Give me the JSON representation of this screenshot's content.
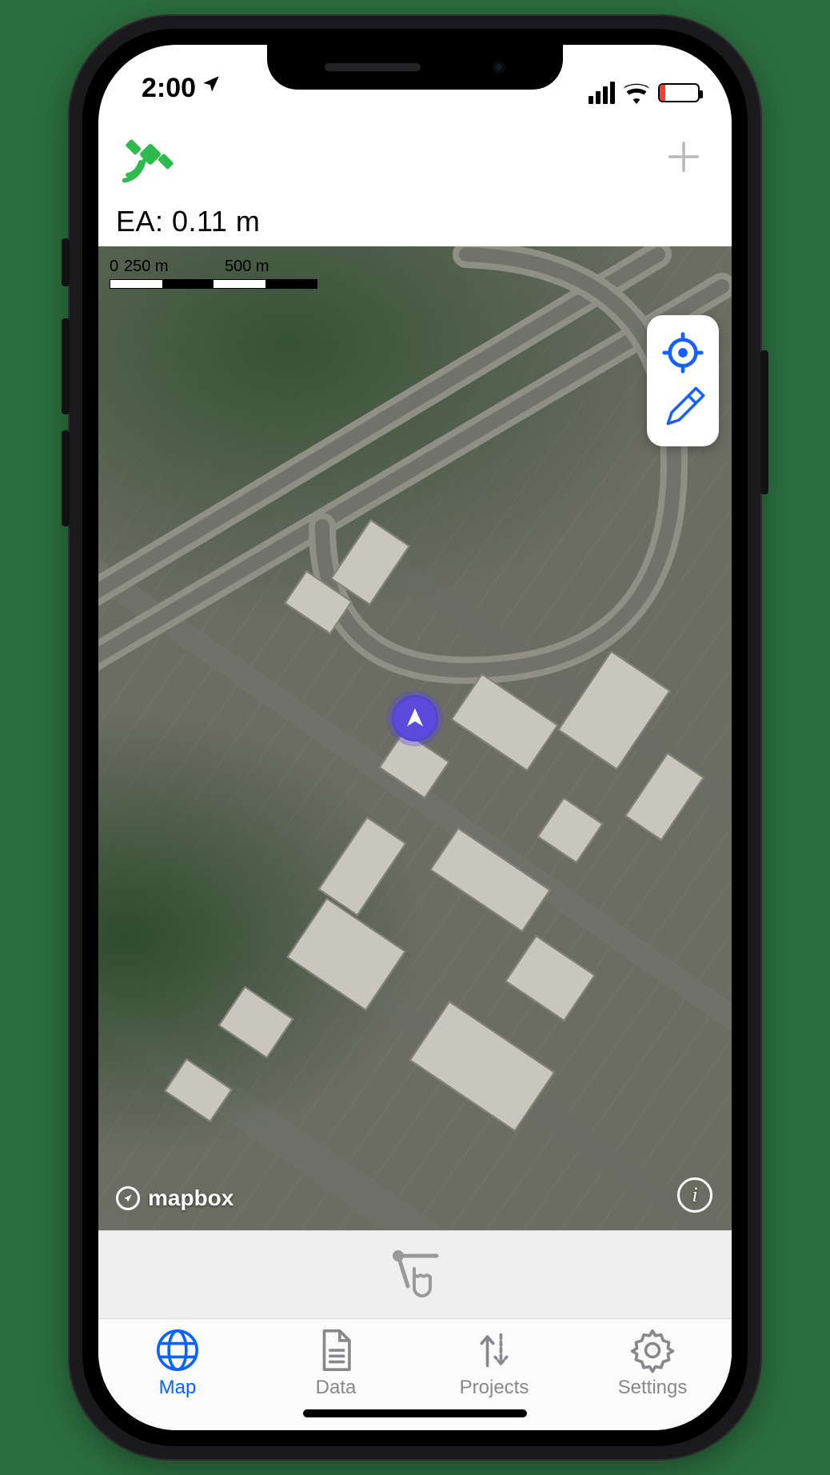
{
  "statusbar": {
    "time": "2:00",
    "location_services_on": true,
    "battery_low": true
  },
  "appbar": {
    "gps_status": "connected"
  },
  "accuracy_label": "EA: 0.11 m",
  "scale": {
    "ticks": [
      "0",
      "250 m",
      "500 m"
    ]
  },
  "map": {
    "attribution": "mapbox",
    "tools": {
      "locate": "center-on-me",
      "draw": "draw"
    }
  },
  "tabs": [
    {
      "id": "map",
      "label": "Map",
      "active": true
    },
    {
      "id": "data",
      "label": "Data",
      "active": false
    },
    {
      "id": "projects",
      "label": "Projects",
      "active": false
    },
    {
      "id": "settings",
      "label": "Settings",
      "active": false
    }
  ]
}
